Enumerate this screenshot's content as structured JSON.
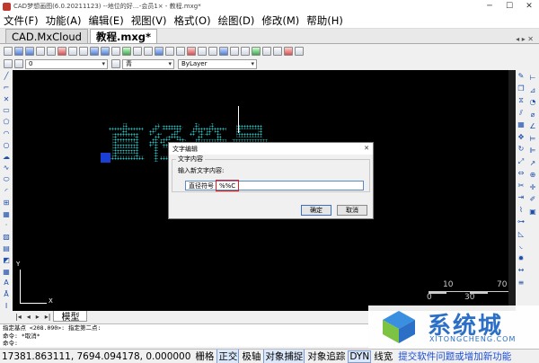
{
  "window": {
    "title": "CAD梦想画图(6.0.20211123) --地位的好…-会员1× - 教程.mxg*"
  },
  "menu": [
    "文件(F)",
    "功能(A)",
    "编辑(E)",
    "视图(V)",
    "格式(O)",
    "绘图(D)",
    "修改(M)",
    "帮助(H)"
  ],
  "tabs": [
    {
      "label": "CAD.MxCloud"
    },
    {
      "label": "教程.mxg*"
    }
  ],
  "propbar": {
    "layer": "0",
    "color": "青",
    "linetype": "ByLayer"
  },
  "canvas": {
    "text": "直径符号",
    "ucs_x": "X",
    "ucs_y": "Y",
    "scale_labels": [
      "10",
      "70",
      "0",
      "30"
    ]
  },
  "dialog": {
    "title": "文字编辑",
    "group_label": "文字内容",
    "prompt": "输入新文字内容:",
    "input_part1": "直径符号",
    "input_part2": "%%C",
    "ok_label": "确定",
    "cancel_label": "取消"
  },
  "model_tab": "模型",
  "cmdline": {
    "line1": "指定基点 <208.090>:   指定第二点:",
    "line2": "命令: *取消*",
    "line3": "命令:"
  },
  "status": {
    "coords": "17381.863111,  7694.094178,  0.000000",
    "toggles": [
      {
        "label": "栅格",
        "on": false
      },
      {
        "label": "正交",
        "on": true
      },
      {
        "label": "极轴",
        "on": false
      },
      {
        "label": "对象捕捉",
        "on": true
      },
      {
        "label": "对象追踪",
        "on": false
      },
      {
        "label": "DYN",
        "on": true
      },
      {
        "label": "线宽",
        "on": false
      }
    ],
    "link": "提交软件问题或增加新功能"
  },
  "watermark": {
    "name": "系统城",
    "domain": "XITONGCHENG.COM"
  },
  "colors": {
    "canvas": "#000000",
    "text": "#22c3c3",
    "grip": "#1a3fd6",
    "highlight": "#e02020",
    "link": "#1a4fd6"
  }
}
